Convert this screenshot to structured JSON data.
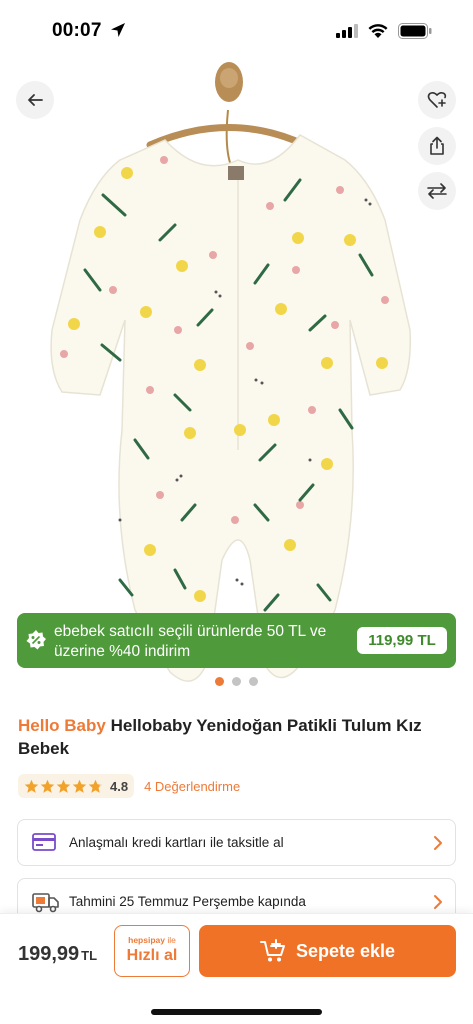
{
  "status_bar": {
    "time": "00:07"
  },
  "product": {
    "brand": "Hello Baby",
    "title": "Hellobaby Yenidoğan Patikli Tulum Kız Bebek",
    "image_description_icon": "baby-onesie-image"
  },
  "promo": {
    "text": "ebebek satıcılı seçili ürünlerde 50 TL ve üzerine %40 indirim",
    "price": "119,99 TL",
    "color": "#4f9a3b"
  },
  "carousel": {
    "total_dots": 3,
    "active_index": 0
  },
  "rating": {
    "stars": 4.8,
    "value_label": "4.8",
    "count_label": "4 Değerlendirme"
  },
  "info_cards": {
    "installment": "Anlaşmalı kredi kartları ile taksitle al",
    "delivery": "Tahmini 25 Temmuz Perşembe kapında"
  },
  "bottom_bar": {
    "price": "199,99",
    "currency": "TL",
    "quick_pay_brand": "hepsipay",
    "quick_pay_suffix": "ile",
    "quick_pay_label": "Hızlı al",
    "add_to_cart_label": "Sepete ekle"
  },
  "colors": {
    "accent": "#ee7a37",
    "promo_green": "#4f9a3b",
    "star": "#f2a22b"
  }
}
